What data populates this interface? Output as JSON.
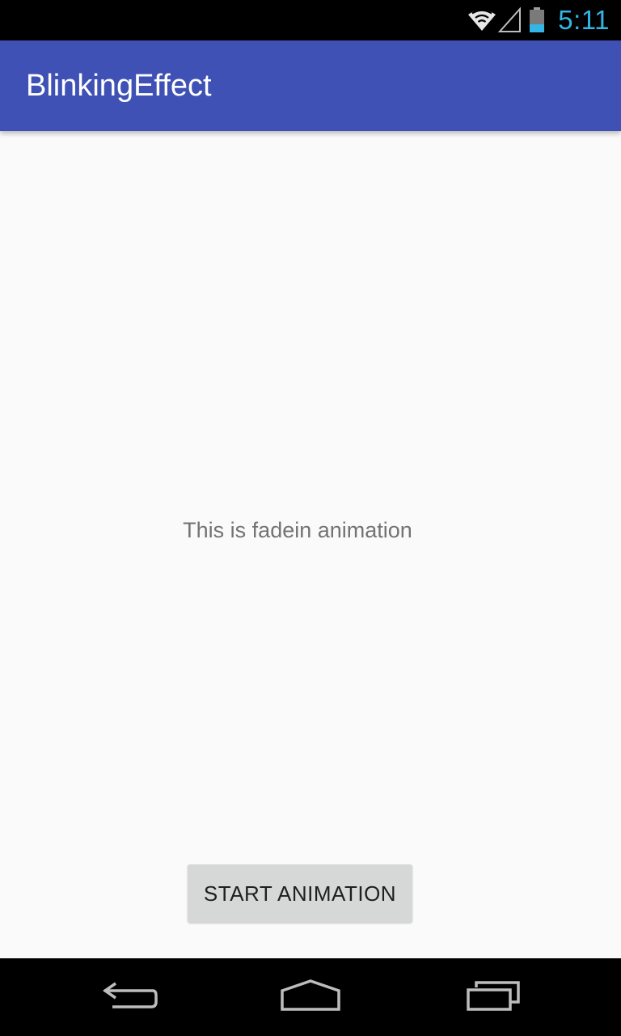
{
  "status_bar": {
    "time": "5:11",
    "icons": [
      "wifi-icon",
      "cell-signal-icon",
      "battery-icon"
    ],
    "clock_color": "#33b5e5"
  },
  "app_bar": {
    "title": "BlinkingEffect",
    "color": "#3f51b5"
  },
  "main": {
    "message": "This is fadein animation",
    "start_button_label": "START ANIMATION"
  },
  "nav_bar": {
    "buttons": [
      "back-icon",
      "home-icon",
      "recent-apps-icon"
    ]
  }
}
